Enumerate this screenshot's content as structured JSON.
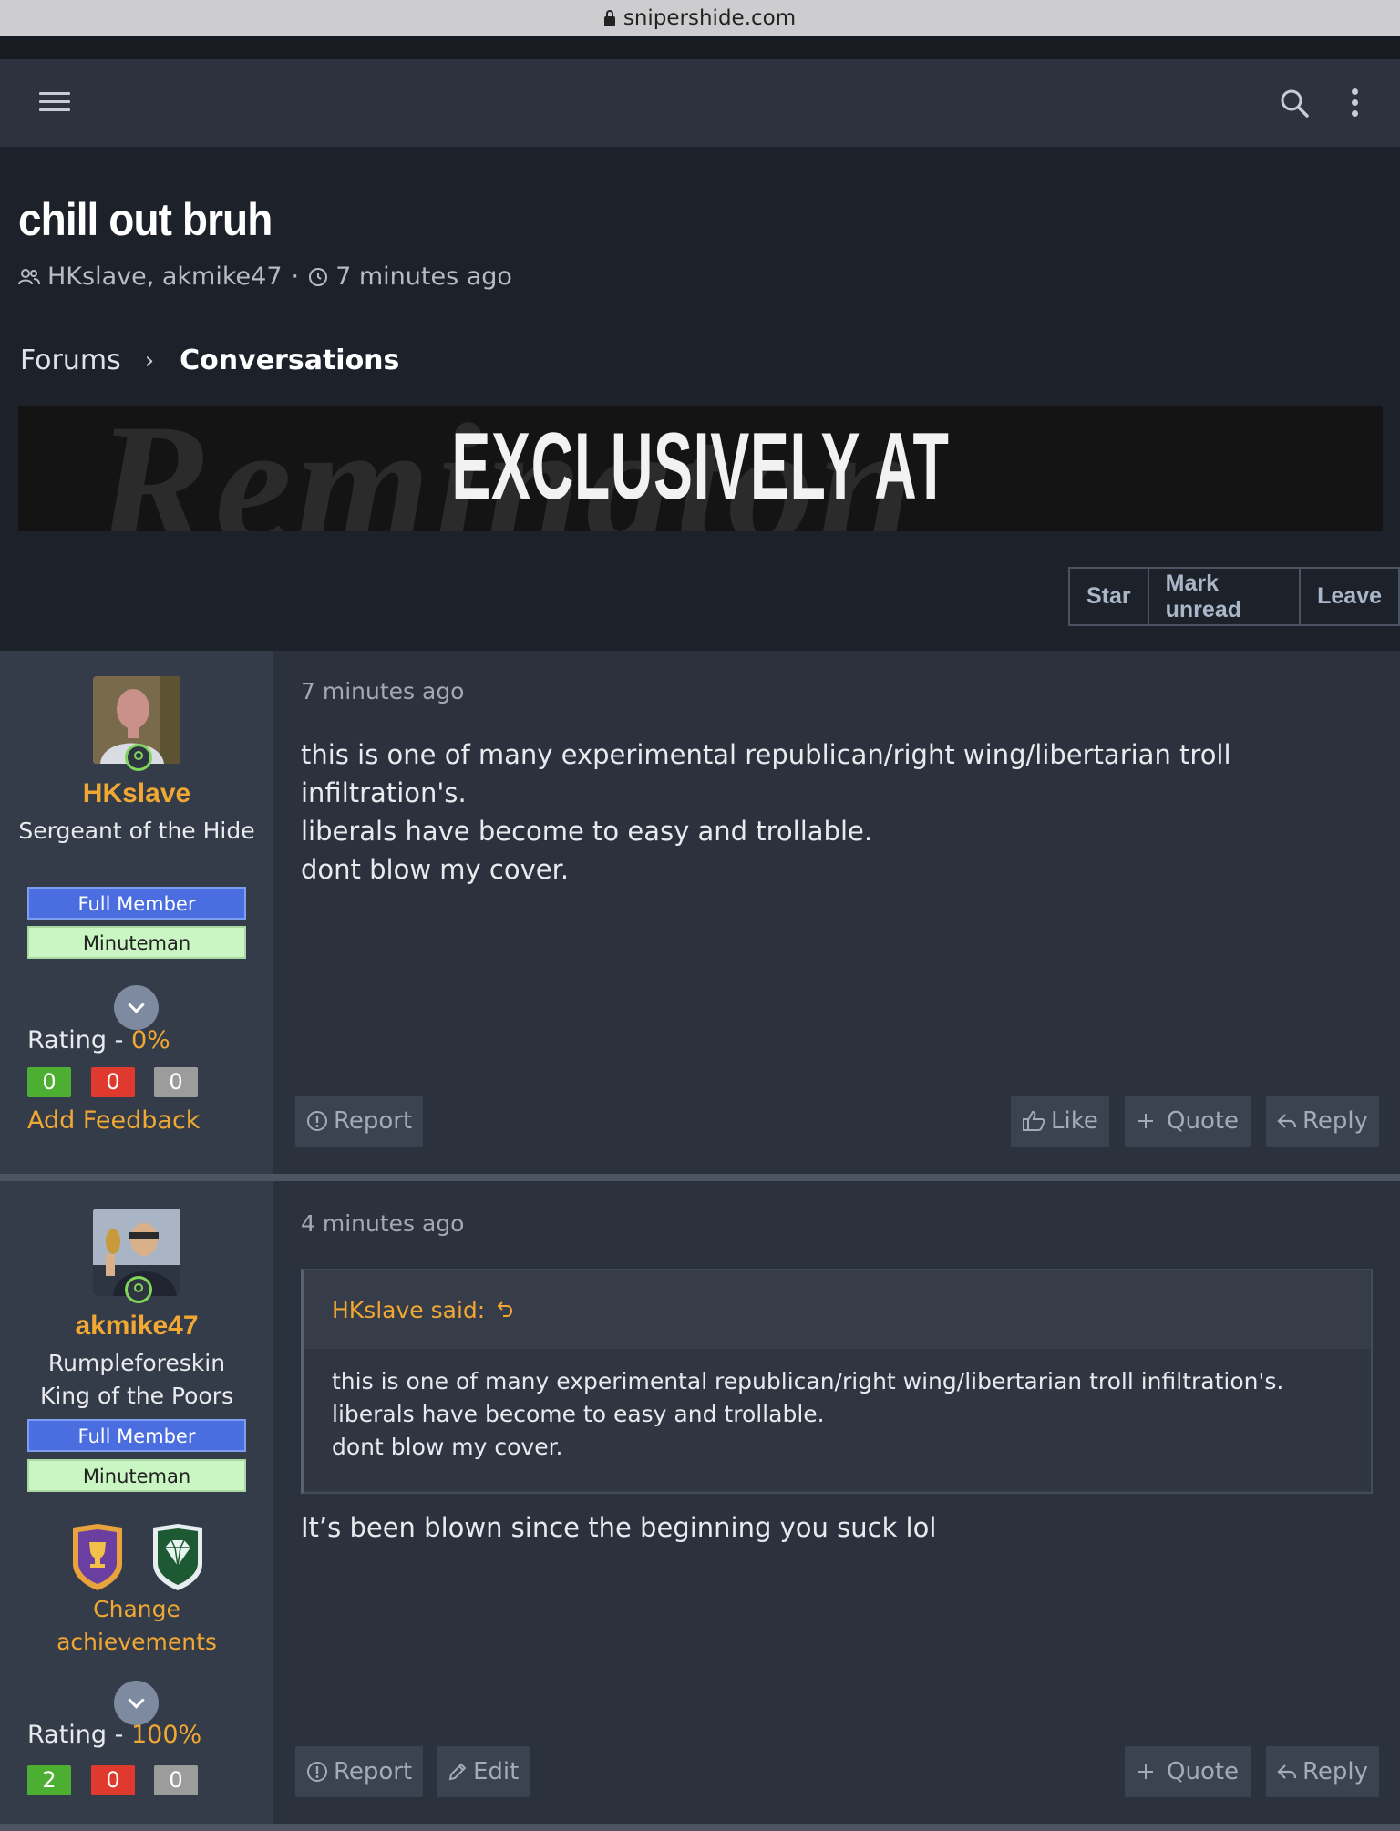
{
  "browser": {
    "url": "snipershide.com"
  },
  "topnav": {
    "menu_icon": "hamburger-icon",
    "search_icon": "search-icon",
    "more_icon": "kebab-icon"
  },
  "conversation": {
    "title": "chill out bruh",
    "participants": "HKslave, akmike47",
    "time_sep": "·",
    "time": "7 minutes ago"
  },
  "breadcrumb": {
    "items": [
      "Forums",
      "Conversations"
    ],
    "separator": "›"
  },
  "banner": {
    "background_word": "Remington",
    "headline": "EXCLUSIVELY AT"
  },
  "actions": {
    "star": "Star",
    "mark_unread": "Mark unread",
    "leave": "Leave"
  },
  "messages": [
    {
      "username": "HKslave",
      "user_title": "Sergeant of the Hide",
      "banners": [
        "Full Member",
        "Minuteman"
      ],
      "rating_label": "Rating - ",
      "rating_value": "0%",
      "rating_counts": {
        "positive": "0",
        "negative": "0",
        "neutral": "0"
      },
      "feedback_link": "Add Feedback",
      "time": "7 minutes ago",
      "body_lines": [
        "this is one of many experimental republican/right wing/libertarian troll infiltration's.",
        "liberals have become to easy and trollable.",
        "dont blow my cover."
      ],
      "buttons": {
        "report": "Report",
        "like": "Like",
        "quote": "Quote",
        "reply": "Reply"
      }
    },
    {
      "username": "akmike47",
      "user_title_lines": [
        "Rumpleforeskin",
        "King of the Poors"
      ],
      "banners": [
        "Full Member",
        "Minuteman"
      ],
      "achievements": [
        "trophy-shield-icon",
        "diamond-shield-icon"
      ],
      "change_achievements_lines": [
        "Change",
        "achievements"
      ],
      "rating_label": "Rating - ",
      "rating_value": "100%",
      "rating_counts": {
        "positive": "2",
        "negative": "0",
        "neutral": "0"
      },
      "time": "4 minutes ago",
      "quote": {
        "attribution": "HKslave said:",
        "lines": [
          "this is one of many experimental republican/right wing/libertarian troll infiltration's.",
          "liberals have become to easy and trollable.",
          "dont blow my cover."
        ]
      },
      "body": "It’s been blown since the beginning you suck lol",
      "buttons": {
        "report": "Report",
        "edit": "Edit",
        "quote": "Quote",
        "reply": "Reply"
      }
    }
  ],
  "colors": {
    "accent": "#f0a833",
    "full_member": "#4a6ee0",
    "minuteman": "#c9f6c2",
    "online": "#7fd65b",
    "positive": "#4caf32",
    "negative": "#e03a2e",
    "neutral": "#9c9c9c"
  }
}
